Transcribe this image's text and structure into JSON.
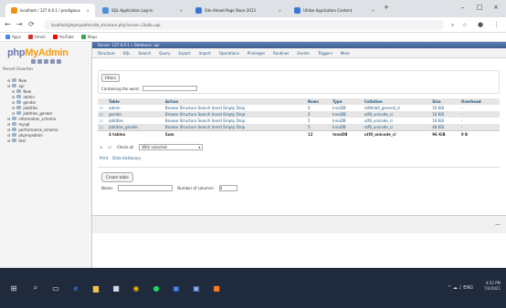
{
  "browser": {
    "tabs": [
      {
        "label": "localhost / 127.0.0.1 / prodigious",
        "favicon_color": "#f29111"
      },
      {
        "label": "SQL Application Log-In",
        "favicon_color": "#4a90d9"
      },
      {
        "label": "Site Ahead Page Store 2013",
        "favicon_color": "#3b77d6"
      },
      {
        "label": "Utilize Application Content",
        "favicon_color": "#3b77d6"
      }
    ],
    "window_controls": [
      "–",
      "□",
      "×"
    ],
    "nav": {
      "back": "←",
      "forward": "→",
      "reload": "⟳"
    },
    "url": "localhost/phpmyadmin/db_structure.php?server=1&db=api",
    "bookmarks": [
      {
        "label": "Apps",
        "color": "#4285f4"
      },
      {
        "label": "Gmail",
        "color": "#d93025"
      },
      {
        "label": "YouTube",
        "color": "#ff0000"
      },
      {
        "label": "Maps",
        "color": "#34a853"
      }
    ]
  },
  "sidebar": {
    "logo_main": "php",
    "logo_accent": "MyAdmin",
    "recent_label": "Recent   Favorites",
    "tree": [
      {
        "label": "New",
        "indent": 1,
        "selected": false
      },
      {
        "label": "api",
        "indent": 1,
        "selected": false
      },
      {
        "label": "New",
        "indent": 2,
        "selected": false
      },
      {
        "label": "admin",
        "indent": 2,
        "selected": false
      },
      {
        "label": "gender",
        "indent": 2,
        "selected": false
      },
      {
        "label": "jobtitles",
        "indent": 2,
        "selected": false
      },
      {
        "label": "jobtitles_gender",
        "indent": 2,
        "selected": false
      },
      {
        "label": "information_schema",
        "indent": 1,
        "selected": false
      },
      {
        "label": "mysql",
        "indent": 1,
        "selected": false
      },
      {
        "label": "performance_schema",
        "indent": 1,
        "selected": false
      },
      {
        "label": "phpmyadmin",
        "indent": 1,
        "selected": false
      },
      {
        "label": "test",
        "indent": 1,
        "selected": false
      }
    ]
  },
  "main": {
    "breadcrumb": "Server: 127.0.0.1  »  Database: api",
    "menu": [
      "Structure",
      "SQL",
      "Search",
      "Query",
      "Export",
      "Import",
      "Operations",
      "Privileges",
      "Routines",
      "Events",
      "Triggers",
      "More"
    ],
    "filters_button": "Filters",
    "filters_label": "Containing the word:",
    "columns": [
      "Table",
      "Action",
      "Rows",
      "Type",
      "Collation",
      "Size",
      "Overhead"
    ],
    "actions": [
      "Browse",
      "Structure",
      "Search",
      "Insert",
      "Empty",
      "Drop"
    ],
    "rows": [
      {
        "table": "admin",
        "rows": "0",
        "type": "InnoDB",
        "collation": "utf8mb4_general_ci",
        "size": "16 KiB",
        "overhead": "-"
      },
      {
        "table": "gender",
        "rows": "2",
        "type": "InnoDB",
        "collation": "utf8_unicode_ci",
        "size": "16 KiB",
        "overhead": "-"
      },
      {
        "table": "jobtitles",
        "rows": "5",
        "type": "InnoDB",
        "collation": "utf8_unicode_ci",
        "size": "16 KiB",
        "overhead": "-"
      },
      {
        "table": "jobtitles_gender",
        "rows": "5",
        "type": "InnoDB",
        "collation": "utf8_unicode_ci",
        "size": "48 KiB",
        "overhead": "-"
      }
    ],
    "summary": {
      "label": "4 tables",
      "sum": "Sum",
      "rows": "12",
      "type": "InnoDB",
      "collation": "utf8_unicode_ci",
      "size": "96 KiB",
      "overhead": "0 B"
    },
    "check_all": "Check all",
    "with_selected": "With selected:",
    "print": "Print",
    "data_dictionary": "Data dictionary",
    "create_table": "Create table",
    "name_label": "Name:",
    "columns_label": "Number of columns:",
    "columns_value": "4",
    "console_toggle": "—"
  },
  "taskbar": {
    "time": "4:52 PM",
    "date": "7/4/2021",
    "tray": "^ ☁ ♪ ENG"
  }
}
